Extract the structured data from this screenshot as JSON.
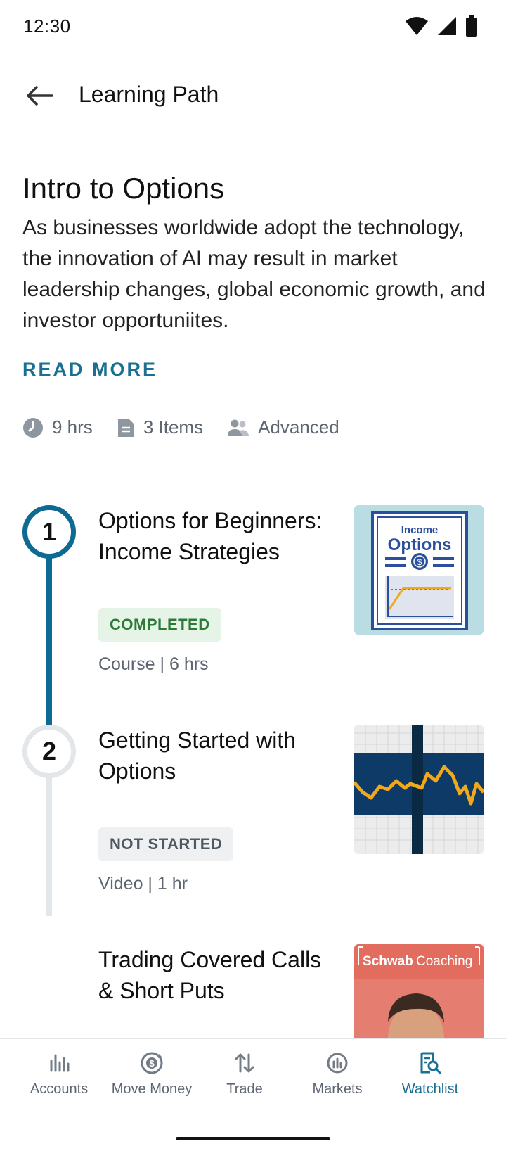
{
  "status": {
    "time": "12:30",
    "icons": [
      "wifi-icon",
      "signal-icon",
      "battery-icon"
    ]
  },
  "header": {
    "title": "Learning Path",
    "back_icon": "arrow-left-icon"
  },
  "intro": {
    "title": "Intro to Options",
    "description": "As businesses worldwide adopt the technology, the innovation of AI may result in market leadership changes, global economic growth, and investor opportuniites.",
    "read_more": "READ MORE"
  },
  "meta": {
    "duration": "9 hrs",
    "items": "3 Items",
    "level": "Advanced"
  },
  "path_items": [
    {
      "number": "1",
      "title": "Options for Beginners: Income Strategies",
      "status": "COMPLETED",
      "info": "Course | 6 hrs",
      "thumb": {
        "line1": "Income",
        "line2": "Options"
      }
    },
    {
      "number": "2",
      "title": "Getting Started with Options",
      "status": "NOT STARTED",
      "info": "Video | 1 hr"
    },
    {
      "title": "Trading Covered Calls & Short Puts",
      "thumb": {
        "brand": "Schwab",
        "label": "Coaching"
      }
    }
  ],
  "nav": {
    "items": [
      {
        "label": "Accounts",
        "icon": "bar-chart-icon"
      },
      {
        "label": "Move Money",
        "icon": "money-transfer-icon"
      },
      {
        "label": "Trade",
        "icon": "trade-arrows-icon"
      },
      {
        "label": "Markets",
        "icon": "markets-icon"
      },
      {
        "label": "Watchlist",
        "icon": "watchlist-icon"
      }
    ],
    "active": "Watchlist"
  },
  "colors": {
    "accent": "#1b6f93",
    "completed_bg": "#e6f4e8",
    "completed_text": "#2c7a36",
    "navy": "#0d3a66",
    "orange": "#f1a81c"
  }
}
